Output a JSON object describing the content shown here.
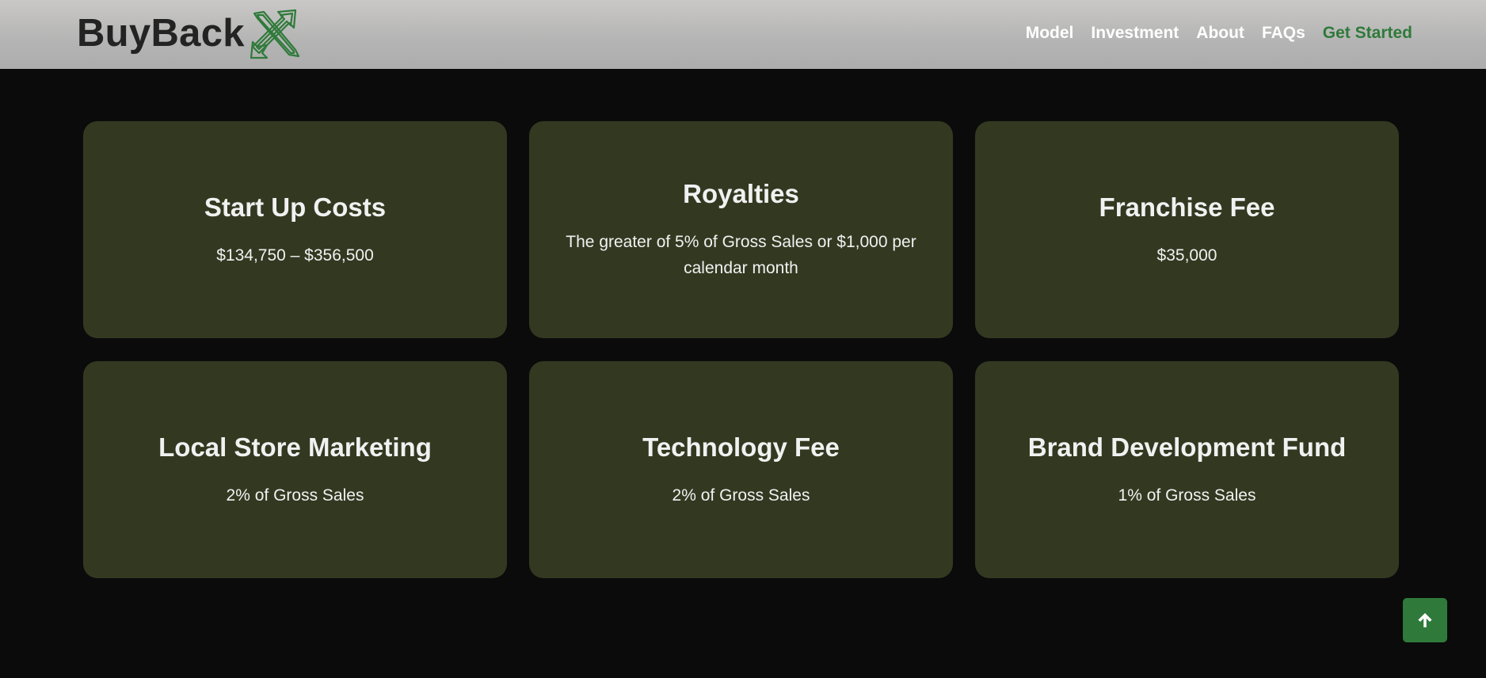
{
  "brand": {
    "name": "BuyBack",
    "accent_color": "#2f7a3a",
    "logo_mark_icon": "crossed-arrows-x-icon"
  },
  "nav": {
    "items": [
      {
        "label": "Model"
      },
      {
        "label": "Investment"
      },
      {
        "label": "About"
      },
      {
        "label": "FAQs"
      }
    ],
    "cta_label": "Get Started"
  },
  "cards": [
    {
      "title": "Start Up Costs",
      "value": "$134,750 – $356,500"
    },
    {
      "title": "Royalties",
      "value": "The greater of 5% of Gross Sales or $1,000 per calendar month"
    },
    {
      "title": "Franchise Fee",
      "value": "$35,000"
    },
    {
      "title": "Local Store Marketing",
      "value": "2% of Gross Sales"
    },
    {
      "title": "Technology Fee",
      "value": "2% of Gross Sales"
    },
    {
      "title": "Brand Development Fund",
      "value": "1% of Gross Sales"
    }
  ],
  "scroll_top_icon": "arrow-up-icon",
  "colors": {
    "page_background": "#0b0b0b",
    "card_background": "#333921",
    "card_text": "#f1f1f1"
  }
}
